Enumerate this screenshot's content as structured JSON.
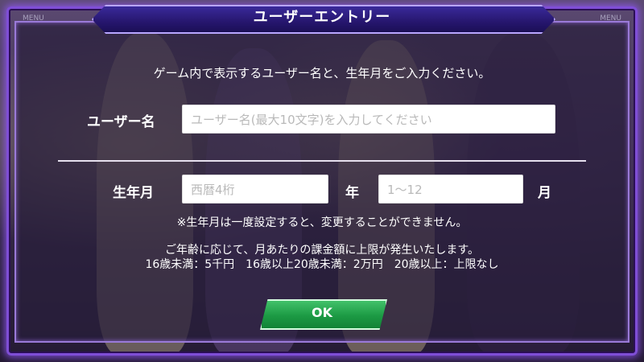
{
  "header": {
    "title": "ユーザーエントリー"
  },
  "corner": {
    "left": "MENU",
    "right": "MENU"
  },
  "intro": "ゲーム内で表示するユーザー名と、生年月をご入力ください。",
  "username": {
    "label": "ユーザー名",
    "placeholder": "ユーザー名(最大10文字)を入力してください"
  },
  "birth": {
    "label": "生年月",
    "year_placeholder": "西暦4桁",
    "year_unit": "年",
    "month_placeholder": "1～12",
    "month_unit": "月"
  },
  "notes": {
    "warning": "※生年月は一度設定すると、変更することができません。",
    "limit_line1": "ご年齢に応じて、月あたりの課金額に上限が発生いたします。",
    "limit_line2": "16歳未満：5千円　16歳以上20歳未満：2万円　20歳以上：上限なし"
  },
  "ok_button": "OK",
  "colors": {
    "frame": "#7f4ed6",
    "header": "#26166e",
    "ok_button": "#1c9a44"
  }
}
